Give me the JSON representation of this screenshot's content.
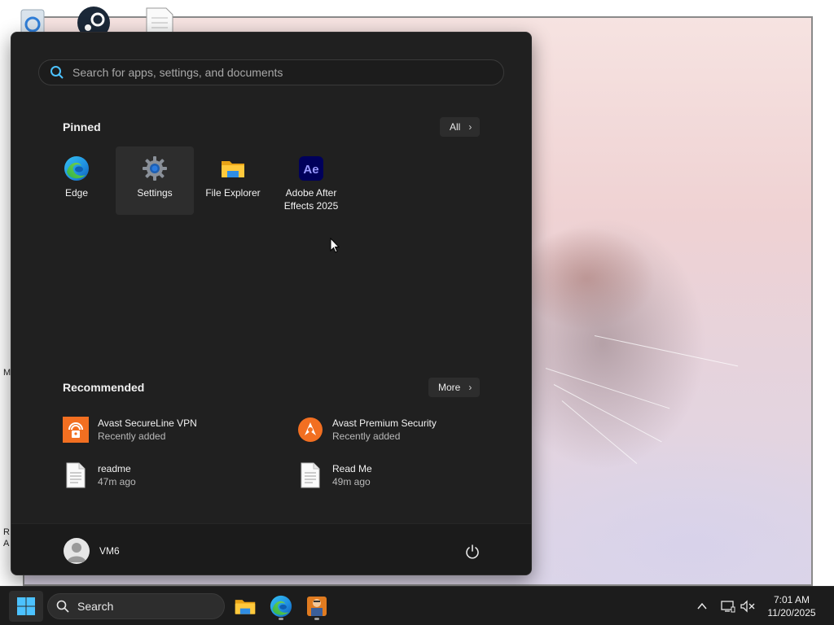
{
  "start_menu": {
    "search_placeholder": "Search for apps, settings, and documents",
    "pinned": {
      "title": "Pinned",
      "all_button": "All",
      "items": [
        {
          "label": "Edge",
          "icon": "edge-icon"
        },
        {
          "label": "Settings",
          "icon": "gear-icon"
        },
        {
          "label": "File Explorer",
          "icon": "folder-icon"
        },
        {
          "label": "Adobe After Effects 2025",
          "icon": "after-effects-icon",
          "icon_text": "Ae"
        }
      ]
    },
    "recommended": {
      "title": "Recommended",
      "more_button": "More",
      "items": [
        {
          "name": "Avast SecureLine VPN",
          "sub": "Recently added",
          "icon": "avast-vpn-icon"
        },
        {
          "name": "Avast Premium Security",
          "sub": "Recently added",
          "icon": "avast-security-icon"
        },
        {
          "name": "readme",
          "sub": "47m ago",
          "icon": "document-icon"
        },
        {
          "name": "Read Me",
          "sub": "49m ago",
          "icon": "document-icon"
        }
      ]
    },
    "user": {
      "name": "VM6",
      "power_icon": "power-icon"
    }
  },
  "taskbar": {
    "search_label": "Search",
    "apps": [
      "file-explorer-icon",
      "edge-icon",
      "app-icon"
    ],
    "tray": [
      "chevron-up-icon",
      "network-icon",
      "volume-muted-icon"
    ],
    "time": "7:01 AM",
    "date": "11/20/2025"
  },
  "desktop": {
    "edge_labels": [
      "R",
      "A",
      "M"
    ]
  },
  "colors": {
    "menu_bg": "#202020",
    "taskbar_bg": "#1c1c1c",
    "accent": "#0078d4",
    "avast_orange": "#f26f21",
    "ae_purple": "#00005b"
  }
}
